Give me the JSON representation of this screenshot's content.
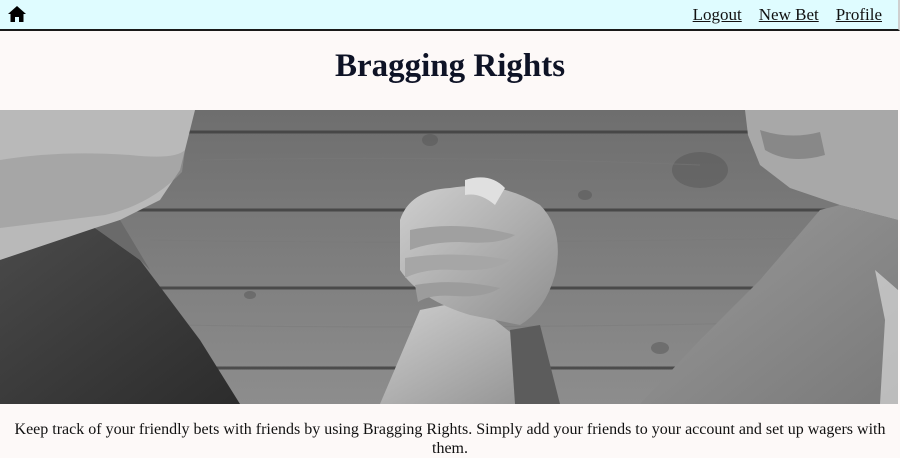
{
  "nav": {
    "home_icon": "home-icon",
    "links": [
      "Logout",
      "New Bet",
      "Profile"
    ]
  },
  "page": {
    "title": "Bragging Rights",
    "description": "Keep track of your friendly bets with friends by using Bragging Rights. Simply add your friends to your account and set up wagers with them."
  },
  "hero": {
    "image_subject": "arm-wrestling handshake photo (grayscale)"
  },
  "colors": {
    "navbar_bg": "#dffcff",
    "page_bg": "#fdf9f8",
    "title": "#0e1326"
  }
}
